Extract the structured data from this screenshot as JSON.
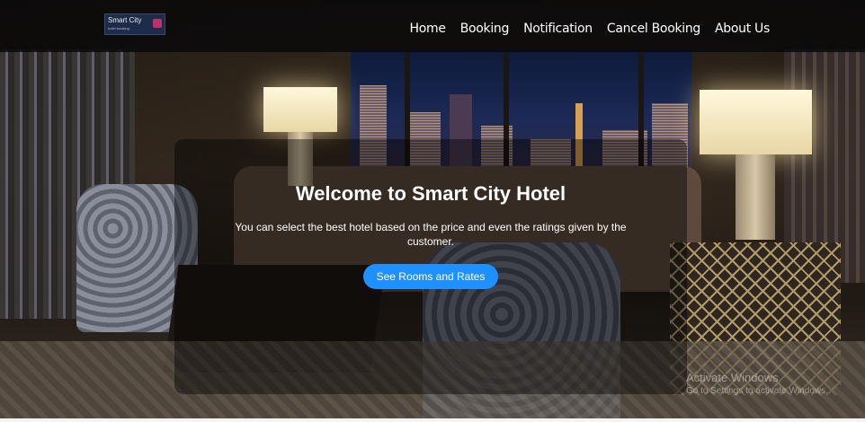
{
  "brand": {
    "name": "Smart City",
    "tagline": "hotel booking"
  },
  "nav": {
    "items": [
      {
        "label": "Home"
      },
      {
        "label": "Booking"
      },
      {
        "label": "Notification"
      },
      {
        "label": "Cancel Booking"
      },
      {
        "label": "About Us"
      }
    ]
  },
  "hero": {
    "title": "Welcome to Smart City Hotel",
    "subtitle": "You can select the best hotel based on the price and even the ratings given by the customer.",
    "cta_label": "See Rooms and Rates"
  },
  "os_watermark": {
    "line1": "Activate Windows",
    "line2": "Go to Settings to activate Windows."
  },
  "colors": {
    "accent": "#1e90ff",
    "nav_bg": "#0a0a0c",
    "text": "#ffffff"
  }
}
